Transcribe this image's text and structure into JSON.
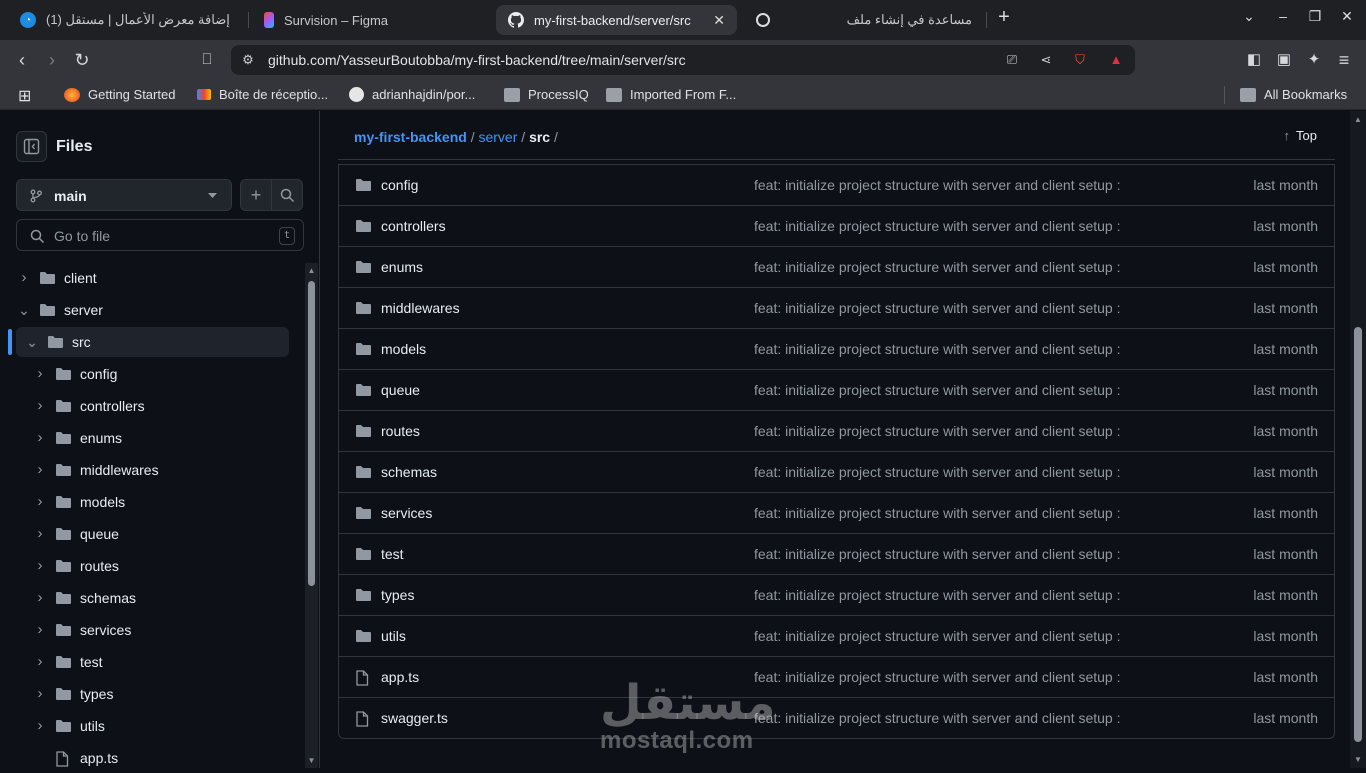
{
  "browser": {
    "tabs": [
      {
        "title": "(1) إضافة معرض الأعمال | مستقل",
        "icon": "mostaql-icon",
        "active": false
      },
      {
        "title": "Survision – Figma",
        "icon": "figma-icon",
        "active": false
      },
      {
        "title": "my-first-backend/server/src",
        "icon": "github-icon",
        "active": true
      },
      {
        "title": "مساعدة في إنشاء ملف",
        "icon": "chatgpt-icon",
        "active": false
      }
    ],
    "url": "github.com/YasseurBoutobba/my-first-backend/tree/main/server/src",
    "bookmarks": [
      {
        "label": "Getting Started",
        "icon": "firefox-icon"
      },
      {
        "label": "Boîte de réceptio...",
        "icon": "gmail-icon"
      },
      {
        "label": "adrianhajdin/por...",
        "icon": "github-icon"
      },
      {
        "label": "ProcessIQ",
        "icon": "folder-icon"
      },
      {
        "label": "Imported From F...",
        "icon": "folder-icon"
      }
    ],
    "all_bookmarks": "All Bookmarks"
  },
  "sidebar": {
    "title": "Files",
    "branch": "main",
    "goto_placeholder": "Go to file",
    "goto_shortcut": "t",
    "tree": [
      {
        "label": "client",
        "depth": 0,
        "expanded": false,
        "type": "folder"
      },
      {
        "label": "server",
        "depth": 0,
        "expanded": true,
        "type": "folder"
      },
      {
        "label": "src",
        "depth": 1,
        "expanded": true,
        "type": "folder",
        "selected": true
      },
      {
        "label": "config",
        "depth": 2,
        "expanded": false,
        "type": "folder"
      },
      {
        "label": "controllers",
        "depth": 2,
        "expanded": false,
        "type": "folder"
      },
      {
        "label": "enums",
        "depth": 2,
        "expanded": false,
        "type": "folder"
      },
      {
        "label": "middlewares",
        "depth": 2,
        "expanded": false,
        "type": "folder"
      },
      {
        "label": "models",
        "depth": 2,
        "expanded": false,
        "type": "folder"
      },
      {
        "label": "queue",
        "depth": 2,
        "expanded": false,
        "type": "folder"
      },
      {
        "label": "routes",
        "depth": 2,
        "expanded": false,
        "type": "folder"
      },
      {
        "label": "schemas",
        "depth": 2,
        "expanded": false,
        "type": "folder"
      },
      {
        "label": "services",
        "depth": 2,
        "expanded": false,
        "type": "folder"
      },
      {
        "label": "test",
        "depth": 2,
        "expanded": false,
        "type": "folder"
      },
      {
        "label": "types",
        "depth": 2,
        "expanded": false,
        "type": "folder"
      },
      {
        "label": "utils",
        "depth": 2,
        "expanded": false,
        "type": "folder"
      },
      {
        "label": "app.ts",
        "depth": 2,
        "expanded": false,
        "type": "file"
      }
    ]
  },
  "breadcrumb": {
    "repo": "my-first-backend",
    "sep1": "/",
    "folder": "server",
    "sep2": "/",
    "current": "src",
    "sep3": "/",
    "top_label": "Top"
  },
  "files": [
    {
      "name": "config",
      "type": "folder",
      "message": "feat: initialize project structure with server and client setup :",
      "date": "last month"
    },
    {
      "name": "controllers",
      "type": "folder",
      "message": "feat: initialize project structure with server and client setup :",
      "date": "last month"
    },
    {
      "name": "enums",
      "type": "folder",
      "message": "feat: initialize project structure with server and client setup :",
      "date": "last month"
    },
    {
      "name": "middlewares",
      "type": "folder",
      "message": "feat: initialize project structure with server and client setup :",
      "date": "last month"
    },
    {
      "name": "models",
      "type": "folder",
      "message": "feat: initialize project structure with server and client setup :",
      "date": "last month"
    },
    {
      "name": "queue",
      "type": "folder",
      "message": "feat: initialize project structure with server and client setup :",
      "date": "last month"
    },
    {
      "name": "routes",
      "type": "folder",
      "message": "feat: initialize project structure with server and client setup :",
      "date": "last month"
    },
    {
      "name": "schemas",
      "type": "folder",
      "message": "feat: initialize project structure with server and client setup :",
      "date": "last month"
    },
    {
      "name": "services",
      "type": "folder",
      "message": "feat: initialize project structure with server and client setup :",
      "date": "last month"
    },
    {
      "name": "test",
      "type": "folder",
      "message": "feat: initialize project structure with server and client setup :",
      "date": "last month"
    },
    {
      "name": "types",
      "type": "folder",
      "message": "feat: initialize project structure with server and client setup :",
      "date": "last month"
    },
    {
      "name": "utils",
      "type": "folder",
      "message": "feat: initialize project structure with server and client setup :",
      "date": "last month"
    },
    {
      "name": "app.ts",
      "type": "file",
      "message": "feat: initialize project structure with server and client setup :",
      "date": "last month"
    },
    {
      "name": "swagger.ts",
      "type": "file",
      "message": "feat: initialize project structure with server and client setup :",
      "date": "last month"
    }
  ],
  "watermark": {
    "arabic": "مستقل",
    "latin": "mostaql.com"
  },
  "colors": {
    "accent": "#4493f8",
    "folder": "#9198a1",
    "bg": "#0d1117",
    "border": "#30363d"
  }
}
